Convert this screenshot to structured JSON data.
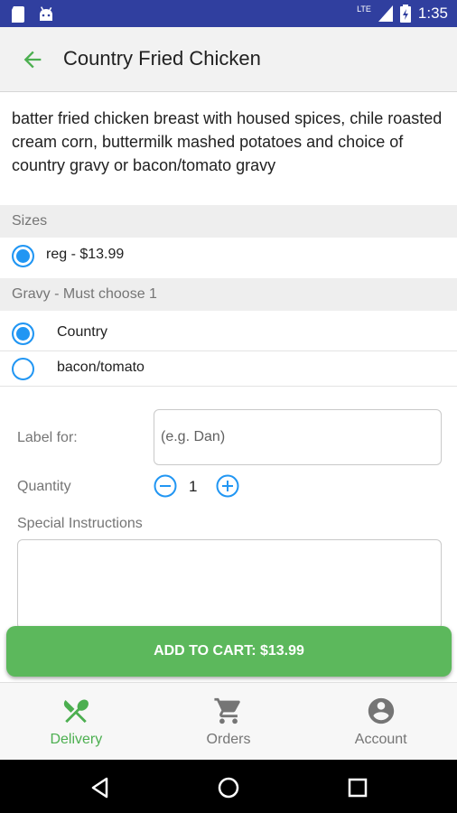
{
  "status_bar": {
    "time": "1:35",
    "network_label": "LTE",
    "icons": [
      "sd-card-icon",
      "android-icon",
      "signal-icon",
      "battery-icon"
    ]
  },
  "header": {
    "title": "Country Fried Chicken",
    "back_icon": "arrow-back-icon"
  },
  "item": {
    "description": "batter fried chicken breast with housed spices, chile roasted cream corn, buttermilk mashed potatoes and choice of country gravy or bacon/tomato gravy"
  },
  "sizes": {
    "heading": "Sizes",
    "options": [
      {
        "label": "reg - $13.99",
        "selected": true
      }
    ]
  },
  "gravy": {
    "heading": "Gravy - Must choose 1",
    "options": [
      {
        "label": "Country",
        "selected": true
      },
      {
        "label": "bacon/tomato",
        "selected": false
      }
    ]
  },
  "form": {
    "label_for": "Label for:",
    "label_placeholder": "(e.g. Dan)",
    "quantity_label": "Quantity",
    "quantity_value": "1",
    "special_instructions_label": "Special Instructions",
    "special_instructions_value": ""
  },
  "cart_button": {
    "label": "ADD TO CART: $13.99"
  },
  "bottom_nav": {
    "items": [
      {
        "label": "Delivery",
        "icon": "fork-knife-icon",
        "active": true
      },
      {
        "label": "Orders",
        "icon": "cart-icon",
        "active": false
      },
      {
        "label": "Account",
        "icon": "account-icon",
        "active": false
      }
    ]
  },
  "colors": {
    "status_bar": "#303f9f",
    "accent_blue": "#2196f3",
    "accent_green": "#4caf50",
    "cart_button": "#5cb85c"
  }
}
